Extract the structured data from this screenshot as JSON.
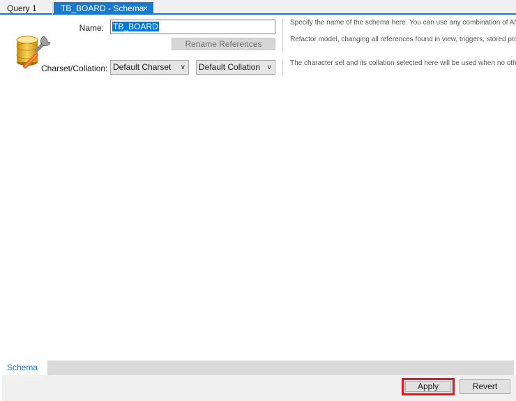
{
  "tabs": [
    {
      "label": "Query 1"
    },
    {
      "label": "TB_BOARD - Schema",
      "close": "×"
    }
  ],
  "form": {
    "name_label": "Name:",
    "name_value": "TB_BOARD",
    "rename_label": "Rename References",
    "charset_label": "Charset/Collation:",
    "charset_value": "Default Charset",
    "collation_value": "Default Collation"
  },
  "help": {
    "line1": "Specify the name of the schema here. You can use any combination of ANSI",
    "line2": "Refactor model, changing all references found in view, triggers, stored procedures",
    "line3": "The character set and its collation selected here will be used when no other"
  },
  "bottom_tabs": [
    {
      "label": "Schema"
    }
  ],
  "footer": {
    "apply_label": "Apply",
    "revert_label": "Revert"
  },
  "colors": {
    "accent": "#1979ca",
    "highlight_box": "#e8141f"
  }
}
